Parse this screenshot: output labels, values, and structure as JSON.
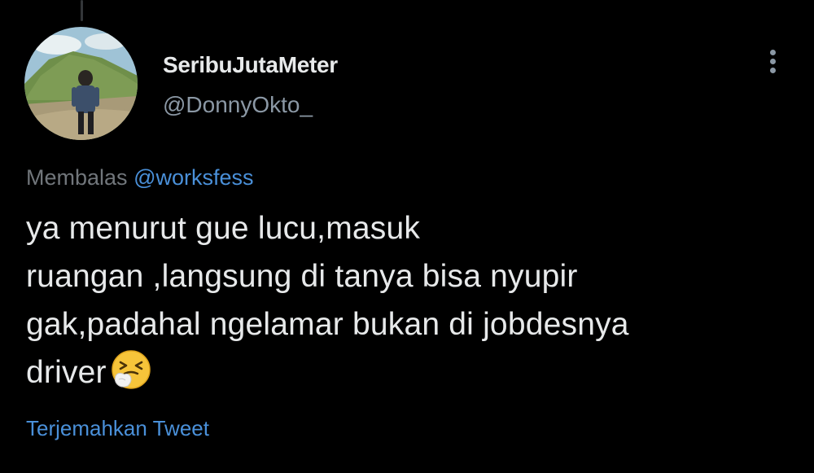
{
  "tweet": {
    "display_name": "SeribuJutaMeter",
    "handle": "@DonnyOkto_",
    "reply_prefix": "Membalas",
    "reply_to": "@worksfess",
    "text_lines": [
      "ya menurut gue lucu,masuk",
      "ruangan ,langsung di tanya bisa nyupir",
      "gak,padahal ngelamar bukan di jobdesnya",
      "driver"
    ],
    "emoji": "sneezing-face",
    "translate_label": "Terjemahkan Tweet"
  },
  "icons": {
    "more": "more-vertical-icon",
    "avatar": "profile-photo"
  },
  "colors": {
    "background": "#000000",
    "primary_text": "#e7e9ea",
    "secondary_text": "#8b98a5",
    "link": "#4a90d9"
  }
}
